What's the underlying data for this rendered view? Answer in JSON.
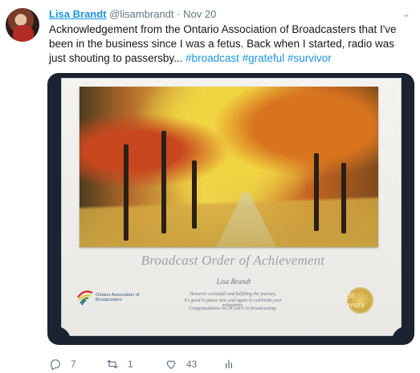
{
  "tweet": {
    "author_name": "Lisa Brandt",
    "author_handle": "@lisambrandt",
    "separator": "·",
    "date": "Nov 20",
    "text_part1": "Acknowledgement from the Ontario Association of Broadcasters that I've been in the business since I was a fetus. Back when I started, radio was just shouting to passersby... ",
    "hashtags": [
      "#broadcast",
      "#grateful",
      "#survivor"
    ],
    "actions": {
      "reply_count": "7",
      "retweet_count": "1",
      "like_count": "43"
    }
  },
  "certificate": {
    "title": "Broadcast Order of Achievement",
    "recipient": "Lisa Brandt",
    "line1": "However colourful and fulfilling the journey,",
    "line2": "it's good to pause now and again to celebrate your milestones.",
    "line3": "Congratulations on 36 years in broadcasting.",
    "org_name": "Ontario Association of Broadcasters",
    "seal_text": "36 years"
  },
  "icons": {
    "reply": "reply-icon",
    "retweet": "retweet-icon",
    "like": "heart-icon",
    "analytics": "analytics-icon",
    "more": "chevron-down-icon"
  },
  "colors": {
    "link": "#1b95e0",
    "text": "#14171a",
    "muted": "#657786"
  }
}
